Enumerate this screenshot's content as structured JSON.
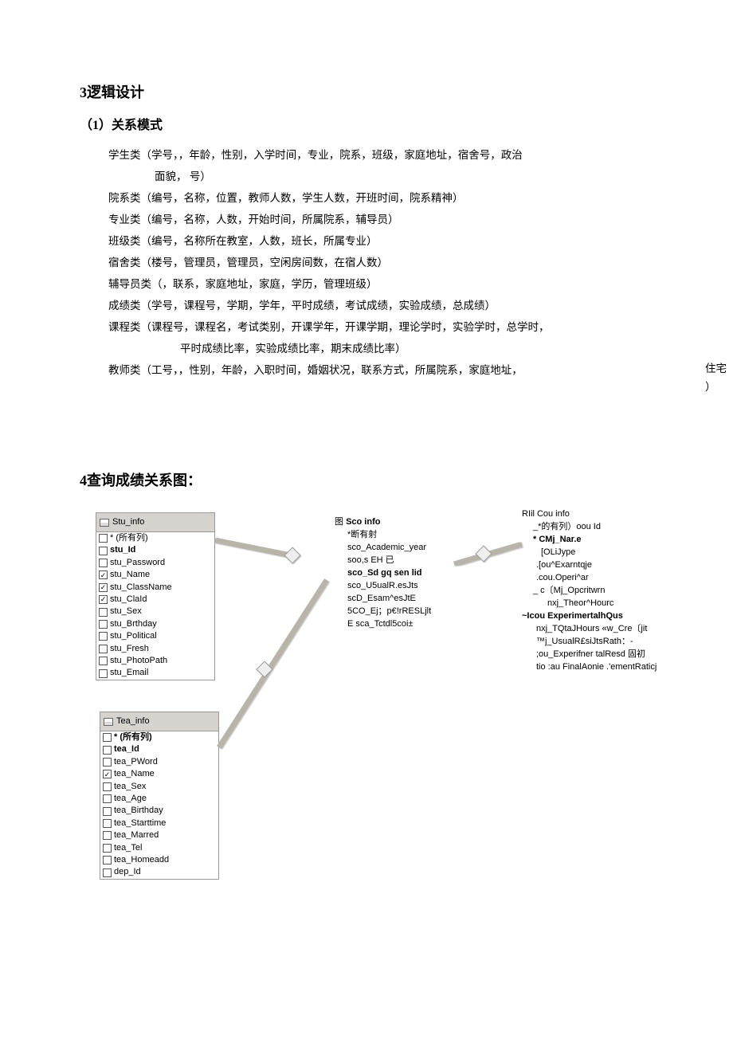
{
  "section3": {
    "heading": "3逻辑设计",
    "sub1": "（1）关系模式",
    "lines": [
      "学生类（学号，，年龄，性别，入学时间，专业，院系，班级，家庭地址，宿舍号，政治",
      "面貌，  号）",
      "院系类（编号，名称，位置，教师人数，学生人数，开班时间，院系精神）",
      "专业类（编号，名称，人数，开始时间，所属院系，辅导员）",
      "班级类（编号，名称所在教室，人数，班长，所属专业）",
      "宿舍类（楼号，管理员，管理员，空闲房间数，在宿人数）",
      "辅导员类（，联系，家庭地址，家庭，学历，管理班级）",
      "成绩类（学号，课程号，学期，学年，平时成绩，考试成绩，实验成绩，总成绩）",
      "课程类（课程号，课程名，考试类别，开课学年，开课学期，理论学时，实验学时，总学时，",
      "平时成绩比率，实验成绩比率，期末成绩比率）",
      "教师类（工号，，性别，年龄，入职时间，婚姻状况，联系方式，所属院系，家庭地址，"
    ],
    "far_right": "住宅\n）"
  },
  "section4": {
    "heading": "4查询成绩关系图："
  },
  "stu": {
    "title": "Stu_info",
    "all_cols": "* (所有列)",
    "rows": [
      {
        "c": false,
        "t": "stu_Id",
        "b": true
      },
      {
        "c": false,
        "t": "stu_Password"
      },
      {
        "c": true,
        "t": "stu_Name"
      },
      {
        "c": true,
        "t": "stu_ClassName"
      },
      {
        "c": true,
        "t": "stu_ClaId"
      },
      {
        "c": false,
        "t": "stu_Sex"
      },
      {
        "c": false,
        "t": "stu_Brthday"
      },
      {
        "c": false,
        "t": "stu_Political"
      },
      {
        "c": false,
        "t": "stu_Fresh"
      },
      {
        "c": false,
        "t": "stu_PhotoPath"
      },
      {
        "c": false,
        "t": "stu_Email"
      }
    ]
  },
  "tea": {
    "title": "Tea_info",
    "all_cols": "* (所有列)",
    "rows": [
      {
        "c": false,
        "t": "tea_Id",
        "b": true
      },
      {
        "c": false,
        "t": "tea_PWord"
      },
      {
        "c": true,
        "t": "tea_Name"
      },
      {
        "c": false,
        "t": "tea_Sex"
      },
      {
        "c": false,
        "t": "tea_Age"
      },
      {
        "c": false,
        "t": "tea_Birthday"
      },
      {
        "c": false,
        "t": "tea_Starttime"
      },
      {
        "c": false,
        "t": "tea_Marred"
      },
      {
        "c": false,
        "t": "tea_Tel"
      },
      {
        "c": false,
        "t": "tea_Homeadd"
      },
      {
        "c": false,
        "t": "dep_Id"
      }
    ]
  },
  "sco": {
    "icon": "图",
    "title": "Sco info",
    "lines": [
      "*断有射",
      "sco_Academic_year",
      "soo,s EH  已",
      "sco_Sd gq sen lid",
      "sco_U5ualR.esJts",
      "scD_Esam^esJtE",
      "5CO_Ej；p€!rRESLjlt",
      "E sca_Tctdl5coi±"
    ]
  },
  "cou": {
    "title": "RIil Cou info",
    "lines": [
      "_*的有列）oou Id",
      "* CMj_Nar.e",
      "[OLiJype",
      ".[ou^Exarntqje",
      ".cou.Operi^ar",
      "_ c〔Mj_Opcritwrn",
      "nxj_Theor^Hourc",
      "~Icou ExperimertalhQus",
      "nxj_TQtaJHours «w_Cre〔jit",
      "™j_UsualR£siJtsRath：-",
      ";ou_Experifner talResd 固初",
      "tio :au FinalAonie .'ementRaticj"
    ]
  }
}
